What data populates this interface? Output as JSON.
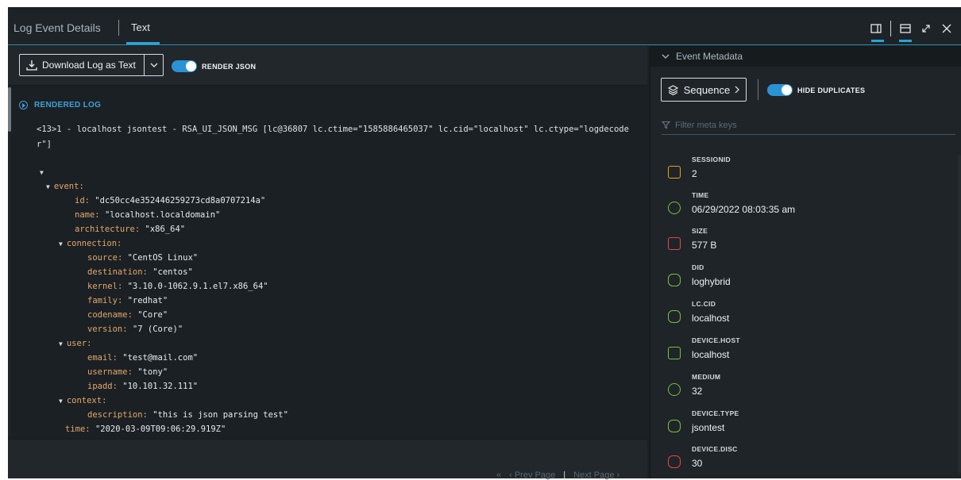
{
  "header": {
    "tab_details": "Log Event Details",
    "tab_text": "Text"
  },
  "toolbar": {
    "download_label": "Download Log as Text",
    "render_json_label": "RENDER JSON",
    "render_json_on": true
  },
  "log": {
    "section_label": "RENDERED LOG",
    "raw_line": "<13>1 - localhost jsontest - RSA_UI_JSON_MSG [lc@36807 lc.ctime=\"1585886465037\" lc.cid=\"localhost\" lc.ctype=\"logdecoder\"]"
  },
  "tree": {
    "root_marker": "▾",
    "event_key": "event",
    "id_key": "id",
    "id_val": "\"dc50cc4e352446259273cd8a0707214a\"",
    "name_key": "name",
    "name_val": "\"localhost.localdomain\"",
    "arch_key": "architecture",
    "arch_val": "\"x86_64\"",
    "conn_key": "connection",
    "source_key": "source",
    "source_val": "\"CentOS Linux\"",
    "dest_key": "destination",
    "dest_val": "\"centos\"",
    "kernel_key": "kernel",
    "kernel_val": "\"3.10.0-1062.9.1.el7.x86_64\"",
    "family_key": "family",
    "family_val": "\"redhat\"",
    "codename_key": "codename",
    "codename_val": "\"Core\"",
    "version_key": "version",
    "version_val": "\"7 (Core)\"",
    "user_key": "user",
    "email_key": "email",
    "email_val": "\"test@mail.com\"",
    "username_key": "username",
    "username_val": "\"tony\"",
    "ipadd_key": "ipadd",
    "ipadd_val": "\"10.101.32.111\"",
    "context_key": "context",
    "desc_key": "description",
    "desc_val": "\"this is json parsing test\"",
    "time_key": "time",
    "time_val": "\"2020-03-09T09:06:29.919Z\""
  },
  "pager": {
    "first": "«",
    "prev": "‹  Prev Page",
    "sep": "|",
    "next": "Next Page  ›"
  },
  "metadata": {
    "title": "Event Metadata",
    "sequence_label": "Sequence",
    "hide_duplicates_label": "HIDE DUPLICATES",
    "filter_placeholder": "Filter meta keys",
    "items": [
      {
        "label": "SESSIONID",
        "value": "2",
        "color": "#e8a317"
      },
      {
        "label": "TIME",
        "value": "06/29/2022 08:03:35 am",
        "color": "#78c043"
      },
      {
        "label": "SIZE",
        "value": "577 B",
        "color": "#e04848"
      },
      {
        "label": "DID",
        "value": "loghybrid",
        "color": "#78c043"
      },
      {
        "label": "LC.CID",
        "value": "localhost",
        "color": "#78c043"
      },
      {
        "label": "DEVICE.HOST",
        "value": "localhost",
        "color": "#78c043"
      },
      {
        "label": "MEDIUM",
        "value": "32",
        "color": "#78c043"
      },
      {
        "label": "DEVICE.TYPE",
        "value": "jsontest",
        "color": "#78c043"
      },
      {
        "label": "DEVICE.DISC",
        "value": "30",
        "color": "#e04848"
      }
    ]
  }
}
